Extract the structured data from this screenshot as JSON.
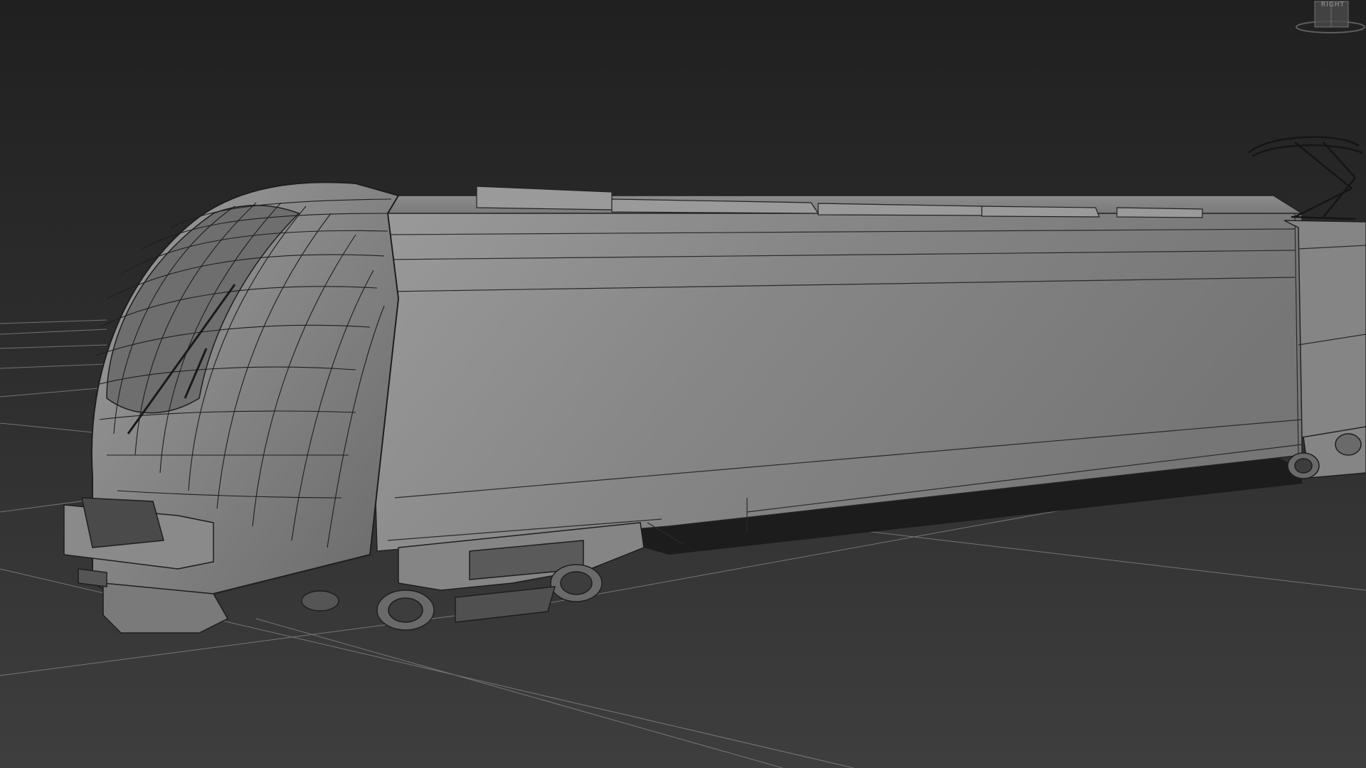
{
  "viewport": {
    "label": "",
    "background": "#262626",
    "grid_color": "#8a8a8a",
    "mesh_fill": "#7e7e7e",
    "mesh_fill_light": "#8e8e8e",
    "mesh_fill_dark": "#5c5c5c",
    "wire_color": "#1e1e1e"
  },
  "viewcube": {
    "label": "RIGHT",
    "icon": "viewcube-icon"
  }
}
